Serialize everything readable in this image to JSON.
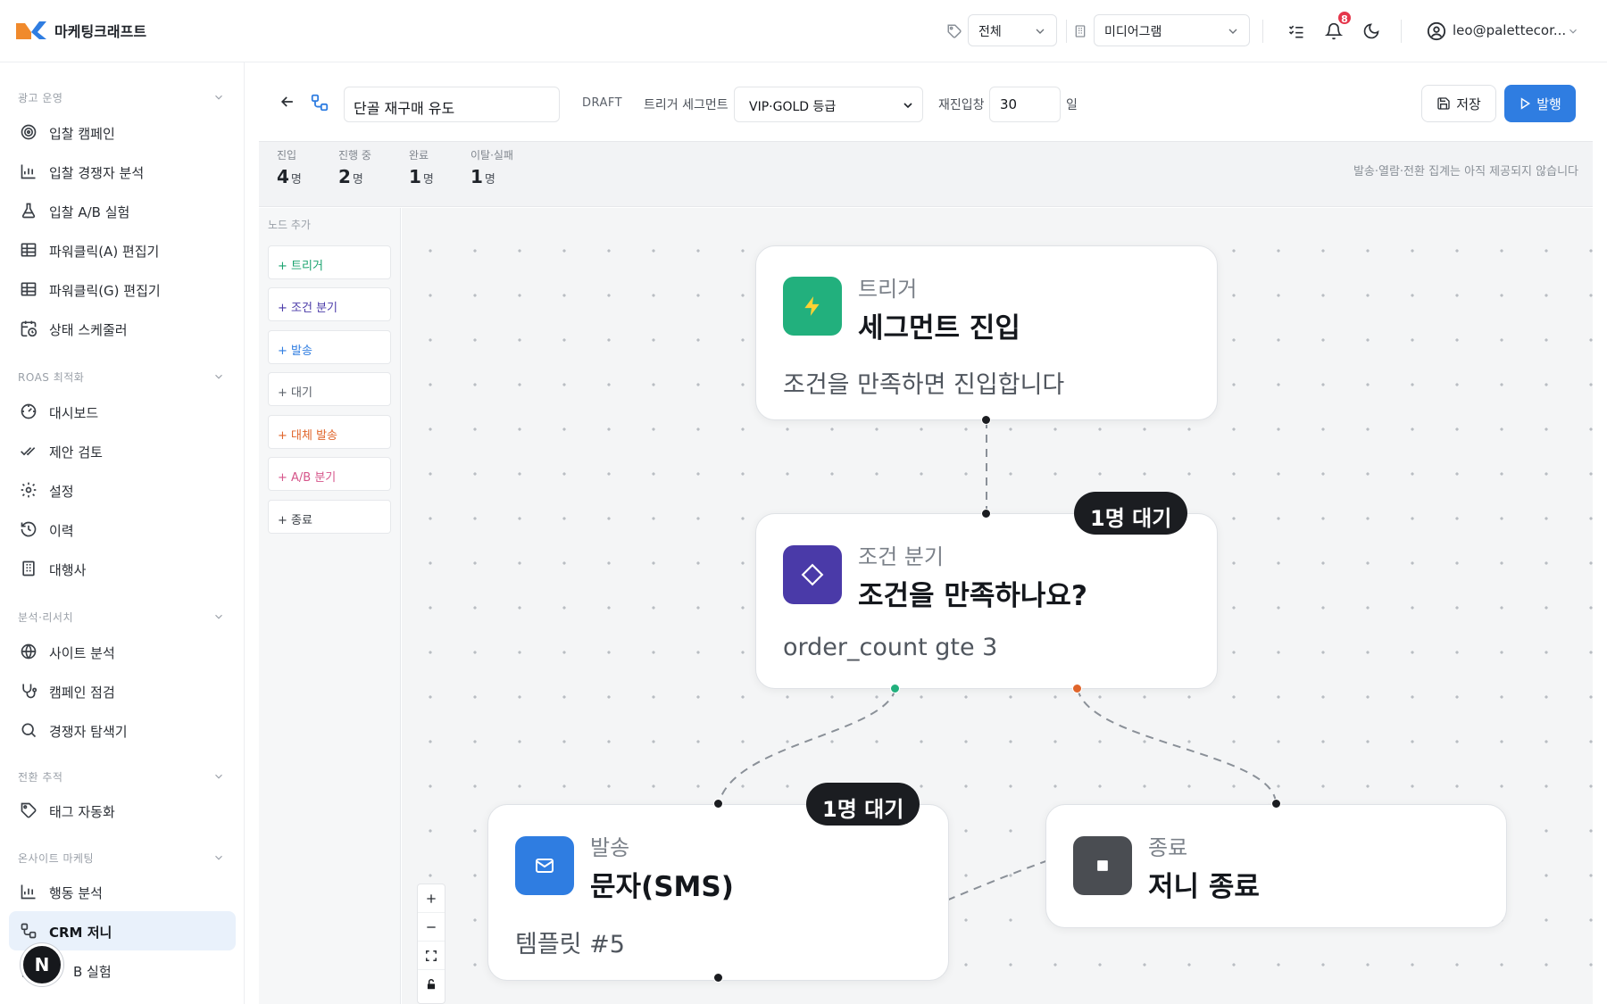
{
  "topbar": {
    "app_title": "마케팅크래프트",
    "filter_select": "전체",
    "account_select": "미디어그램",
    "notification_count": "8",
    "user_email": "leo@palettecor..."
  },
  "sidebar": {
    "groups": [
      {
        "label": "광고 운영",
        "items": [
          {
            "label": "입찰 캠페인",
            "icon": "target-icon"
          },
          {
            "label": "입찰 경쟁자 분석",
            "icon": "bar-chart-icon"
          },
          {
            "label": "입찰 A/B 실험",
            "icon": "flask-icon"
          },
          {
            "label": "파워클릭(A) 편집기",
            "icon": "table-icon"
          },
          {
            "label": "파워클릭(G) 편집기",
            "icon": "table-icon"
          },
          {
            "label": "상태 스케줄러",
            "icon": "calendar-clock-icon"
          }
        ]
      },
      {
        "label": "ROAS 최적화",
        "items": [
          {
            "label": "대시보드",
            "icon": "gauge-icon"
          },
          {
            "label": "제안 검토",
            "icon": "double-check-icon"
          },
          {
            "label": "설정",
            "icon": "gear-icon"
          },
          {
            "label": "이력",
            "icon": "history-icon"
          },
          {
            "label": "대행사",
            "icon": "building-icon"
          }
        ]
      },
      {
        "label": "분석·리서치",
        "items": [
          {
            "label": "사이트 분석",
            "icon": "globe-icon"
          },
          {
            "label": "캠페인 점검",
            "icon": "stethoscope-icon"
          },
          {
            "label": "경쟁자 탐색기",
            "icon": "search-icon"
          }
        ]
      },
      {
        "label": "전환 추적",
        "items": [
          {
            "label": "태그 자동화",
            "icon": "tag-icon"
          }
        ]
      },
      {
        "label": "온사이트 마케팅",
        "items": [
          {
            "label": "행동 분석",
            "icon": "bar-chart-icon"
          },
          {
            "label": "CRM 저니",
            "icon": "workflow-icon",
            "active": true
          },
          {
            "label": "B 실험",
            "icon": "flask-icon"
          }
        ]
      }
    ],
    "fab_label": "N"
  },
  "journey": {
    "name": "단골 재구매 유도",
    "status": "DRAFT",
    "segment_label": "트리거 세그먼트",
    "segment_value": "VIP·GOLD 등급",
    "reentry_label": "재진입창",
    "reentry_value": "30",
    "reentry_unit": "일",
    "save_label": "저장",
    "publish_label": "발행"
  },
  "stats": {
    "items": [
      {
        "label": "진입",
        "value": "4",
        "unit": "명"
      },
      {
        "label": "진행 중",
        "value": "2",
        "unit": "명"
      },
      {
        "label": "완료",
        "value": "1",
        "unit": "명"
      },
      {
        "label": "이탈·실패",
        "value": "1",
        "unit": "명"
      }
    ],
    "note": "발송·열람·전환 집계는 아직 제공되지 않습니다"
  },
  "palette": {
    "title": "노드 추가",
    "buttons": [
      {
        "label": "+ 트리거",
        "color": "#1aa36f"
      },
      {
        "label": "+ 조건 분기",
        "color": "#4a3aa8"
      },
      {
        "label": "+ 발송",
        "color": "#2f7de1"
      },
      {
        "label": "+ 대기",
        "color": "#5b616a"
      },
      {
        "label": "+ 대체 발송",
        "color": "#e0652b"
      },
      {
        "label": "+ A/B 분기",
        "color": "#d6558a"
      },
      {
        "label": "+ 종료",
        "color": "#3a3f46"
      }
    ]
  },
  "nodes": {
    "trigger": {
      "type": "트리거",
      "title": "세그먼트 진입",
      "desc": "조건을 만족하면 진입합니다",
      "color": "#22b07d",
      "icon": "lightning-icon"
    },
    "condition": {
      "type": "조건 분기",
      "title": "조건을 만족하나요?",
      "desc": "order_count gte 3",
      "color": "#4a3aa8",
      "icon": "diamond-icon",
      "waiting": "1명 대기"
    },
    "send": {
      "type": "발송",
      "title": "문자(SMS)",
      "desc": "템플릿 #5",
      "color": "#2f7de1",
      "icon": "mail-icon",
      "waiting": "1명 대기"
    },
    "end": {
      "type": "종료",
      "title": "저니 종료",
      "color": "#4a4d52",
      "icon": "stop-icon"
    }
  }
}
